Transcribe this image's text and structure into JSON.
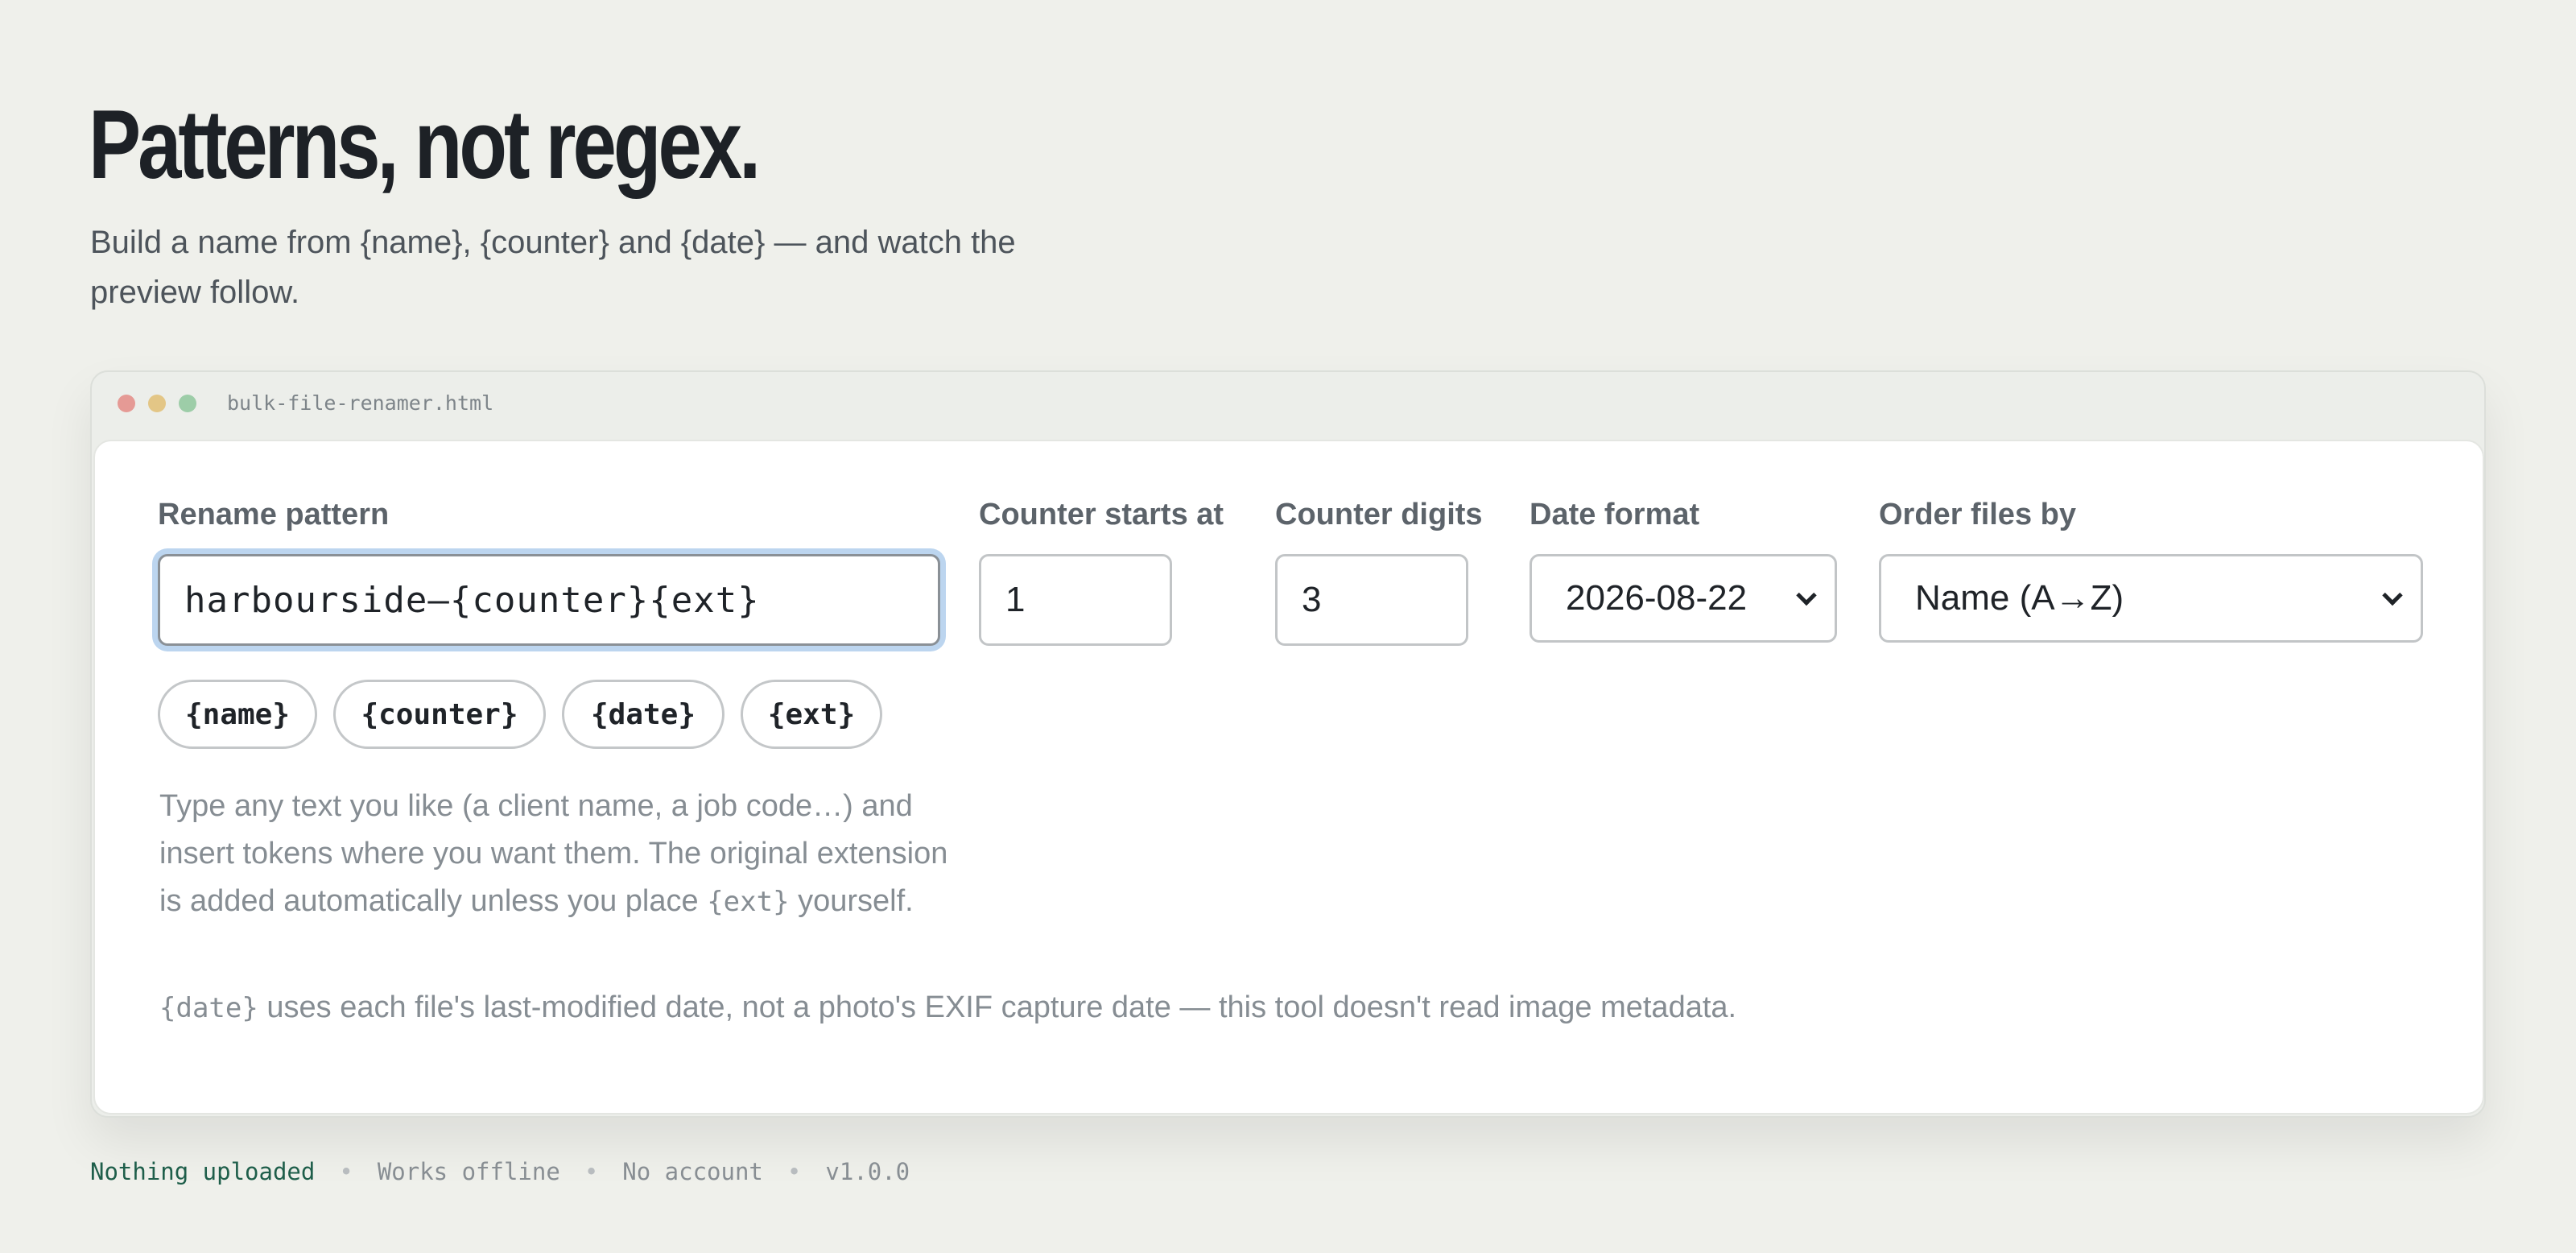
{
  "hero": {
    "title": "Patterns, not regex.",
    "subtitle": "Build a name from {name}, {counter} and {date} — and watch the preview follow."
  },
  "window": {
    "filename": "bulk-file-renamer.html"
  },
  "form": {
    "pattern_label": "Rename pattern",
    "pattern_value": "harbourside–{counter}{ext}",
    "counter_start_label": "Counter starts at",
    "counter_start_value": "1",
    "counter_digits_label": "Counter digits",
    "counter_digits_value": "3",
    "date_format_label": "Date format",
    "date_format_value": "2026-08-22",
    "order_label": "Order files by",
    "order_value": "Name (A→Z)",
    "tokens": [
      "{name}",
      "{counter}",
      "{date}",
      "{ext}"
    ],
    "help_text": "Type any text you like (a client name, a job code…) and insert tokens where you want them. The original extension is added automatically unless you place",
    "help_code": "{ext}",
    "help_tail": "yourself.",
    "date_note_code": "{date}",
    "date_note": "uses each file's last-modified date, not a photo's EXIF capture date — this tool doesn't read image metadata."
  },
  "footer": {
    "items": [
      "Nothing uploaded",
      "Works offline",
      "No account",
      "v1.0.0"
    ]
  },
  "colors": {
    "background": "#eff0eb",
    "focus_ring": "#bcd5ef",
    "footer_accent": "#1e5e4a"
  }
}
